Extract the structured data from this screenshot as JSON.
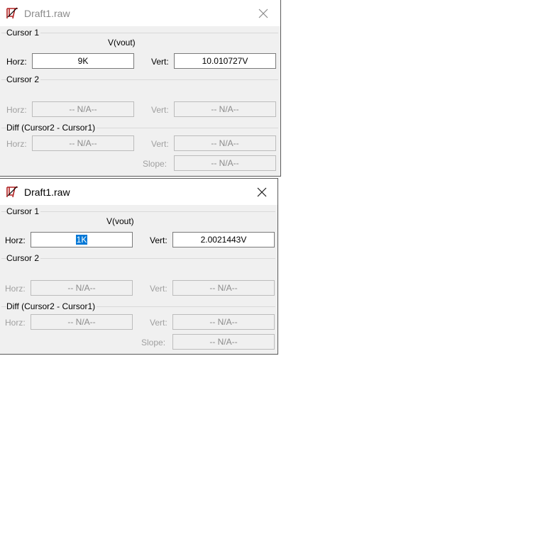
{
  "windows": [
    {
      "title": "Draft1.raw",
      "cursor1": {
        "label": "Cursor 1",
        "trace": "V(vout)",
        "horz_label": "Horz:",
        "horz_value": "9K",
        "vert_label": "Vert:",
        "vert_value": "10.010727V"
      },
      "cursor2": {
        "label": "Cursor 2",
        "horz_label": "Horz:",
        "horz_value": "-- N/A--",
        "vert_label": "Vert:",
        "vert_value": "-- N/A--"
      },
      "diff": {
        "label": "Diff (Cursor2 - Cursor1)",
        "horz_label": "Horz:",
        "horz_value": "-- N/A--",
        "vert_label": "Vert:",
        "vert_value": "-- N/A--",
        "slope_label": "Slope:",
        "slope_value": "-- N/A--"
      }
    },
    {
      "title": "Draft1.raw",
      "cursor1": {
        "label": "Cursor 1",
        "trace": "V(vout)",
        "horz_label": "Horz:",
        "horz_value": "1K",
        "vert_label": "Vert:",
        "vert_value": "2.0021443V"
      },
      "cursor2": {
        "label": "Cursor 2",
        "horz_label": "Horz:",
        "horz_value": "-- N/A--",
        "vert_label": "Vert:",
        "vert_value": "-- N/A--"
      },
      "diff": {
        "label": "Diff (Cursor2 - Cursor1)",
        "horz_label": "Horz:",
        "horz_value": "-- N/A--",
        "vert_label": "Vert:",
        "vert_value": "-- N/A--",
        "slope_label": "Slope:",
        "slope_value": "-- N/A--"
      }
    }
  ],
  "icons": {
    "app": "ltspice-logo-icon",
    "close": "close-icon"
  },
  "colors": {
    "selection": "#0078d7",
    "dialog_bg": "#f0f0f0",
    "disabled_text": "#a0a0a0"
  }
}
